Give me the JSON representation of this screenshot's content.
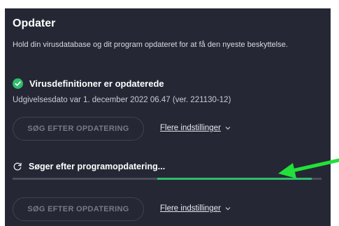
{
  "panel": {
    "title": "Opdater",
    "description": "Hold din virusdatabase og dit program opdateret for at få den nyeste beskyttelse."
  },
  "virus_definitions": {
    "status": "Virusdefinitioner er opdaterede",
    "release_info": "Udgivelsesdato var 1. december 2022 06.47 (ver. 221130-12)",
    "check_button_label": "SØG EFTER OPDATERING",
    "more_settings_label": "Flere indstillinger",
    "status_icon": "check-circle-icon",
    "status_color": "#2fbd6c"
  },
  "program_update": {
    "status": "Søger efter programopdatering...",
    "status_icon": "refresh-icon",
    "check_button_label": "SØG EFTER OPDATERING",
    "more_settings_label": "Flere indstillinger"
  },
  "annotation": {
    "icon": "green-arrow-icon",
    "color": "#22e03a"
  }
}
